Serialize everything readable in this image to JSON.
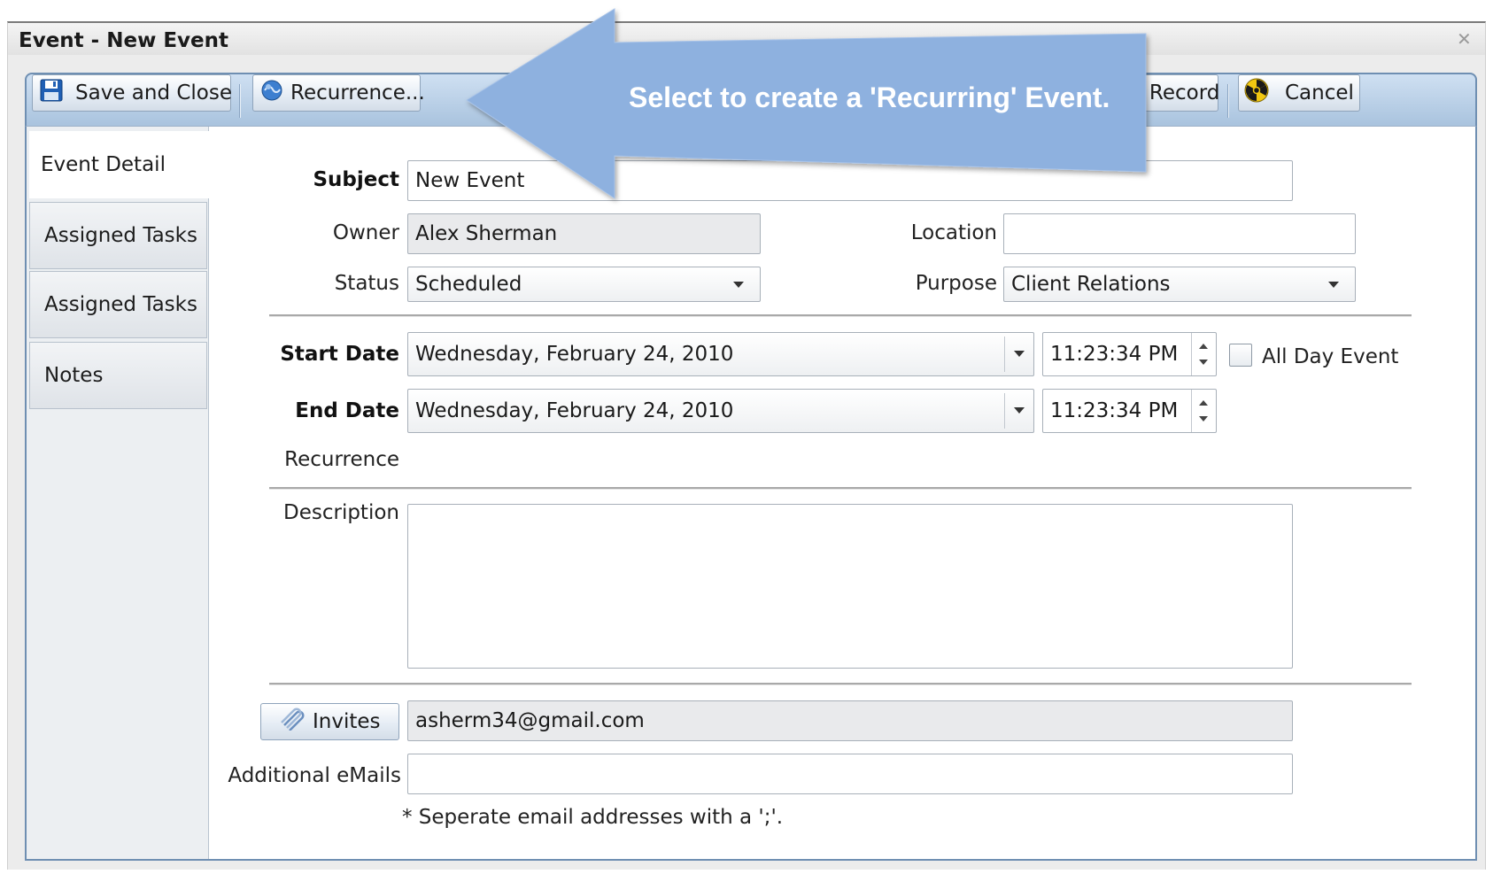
{
  "window": {
    "title": "Event - New Event",
    "close_glyph": "✕"
  },
  "toolbar": {
    "save_close_label": "Save and Close",
    "recurrence_label": "Recurrence...",
    "delete_label": "Delete Record",
    "cancel_label": "Cancel"
  },
  "callout": {
    "text": "Select to create a 'Recurring' Event."
  },
  "nav": {
    "items": [
      {
        "label": "Event Detail",
        "active": true
      },
      {
        "label": "Assigned Tasks",
        "active": false
      },
      {
        "label": "Assigned Tasks",
        "active": false
      },
      {
        "label": "Notes",
        "active": false
      }
    ]
  },
  "form": {
    "subject_label": "Subject",
    "subject_value": "New Event",
    "owner_label": "Owner",
    "owner_value": "Alex Sherman",
    "location_label": "Location",
    "location_value": "",
    "status_label": "Status",
    "status_value": "Scheduled",
    "purpose_label": "Purpose",
    "purpose_value": "Client Relations",
    "start_date_label": "Start Date",
    "start_date_value": "Wednesday, February 24, 2010",
    "start_time_value": "11:23:34 PM",
    "all_day_label": "All Day Event",
    "all_day_checked": false,
    "end_date_label": "End Date",
    "end_date_value": "Wednesday, February 24, 2010",
    "end_time_value": "11:23:34 PM",
    "recurrence_label": "Recurrence",
    "description_label": "Description",
    "description_value": "",
    "invites_button_label": "Invites",
    "invites_value": "asherm34@gmail.com",
    "additional_emails_label": "Additional eMails",
    "additional_emails_value": "",
    "email_hint": "* Seperate email addresses with a ';'."
  },
  "icons": {
    "save": "floppy-disk-icon",
    "recurrence": "globe-icon",
    "delete": "delete-icon",
    "cancel": "radiation-icon",
    "invites": "paperclip-icon",
    "dropdown": "chevron-down-icon"
  },
  "colors": {
    "toolbar_top": "#cfe0f2",
    "toolbar_bottom": "#a9c3de",
    "frame_border": "#6f8fb2",
    "callout_fill": "#8eb1df",
    "callout_text": "#ffffff"
  }
}
